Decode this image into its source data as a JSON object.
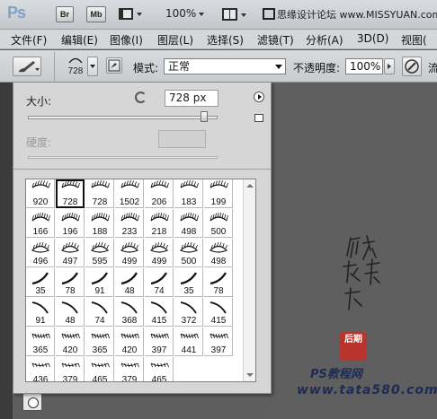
{
  "appbar": {
    "logo": "Ps",
    "btn_bridge": "Br",
    "btn_minibridge": "Mb",
    "zoom": "100%",
    "watermark": "思缘设计论坛 www.MISSYUAN.com"
  },
  "menubar": {
    "items": [
      "文件(F)",
      "编辑(E)",
      "图像(I)",
      "图层(L)",
      "选择(S)",
      "滤镜(T)",
      "分析(A)",
      "3D(D)",
      "视图("
    ]
  },
  "options": {
    "brush_size": "728",
    "mode_label": "模式:",
    "mode_value": "正常",
    "opacity_label": "不透明度:",
    "opacity_value": "100%",
    "flow_label_partial": "流"
  },
  "picker": {
    "size_label": "大小:",
    "size_value": "728 px",
    "size_fraction": 0.93,
    "hardness_label": "硬度:",
    "brush_sizes": [
      [
        "920",
        "728",
        "728",
        "1502",
        "206",
        "183",
        "199"
      ],
      [
        "166",
        "196",
        "188",
        "233",
        "218",
        "498",
        "500"
      ],
      [
        "496",
        "497",
        "595",
        "499",
        "499",
        "500",
        "498"
      ],
      [
        "35",
        "78",
        "91",
        "48",
        "74",
        "35",
        "78"
      ],
      [
        "91",
        "48",
        "74",
        "368",
        "415",
        "372",
        "415"
      ],
      [
        "365",
        "420",
        "365",
        "420",
        "397",
        "441",
        "397"
      ],
      [
        "436",
        "379",
        "465",
        "379",
        "465"
      ]
    ],
    "selected_index": 1
  },
  "overlay": {
    "signature": "他她我帮你",
    "seal_text": "后期",
    "site_a": "PS教程网",
    "site_b": "www.tata580.com"
  }
}
